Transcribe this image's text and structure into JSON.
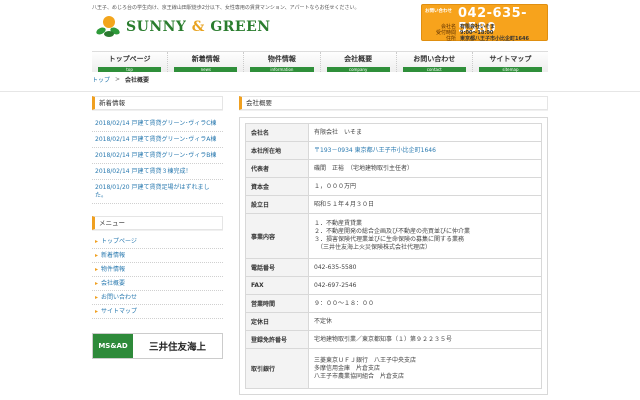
{
  "header": {
    "tagline": "八王子、めじろ台の学生向け、京王線山田駅徒歩2分以下、女性専用の賃貸マンション、アパートならお任せください。",
    "logo_left": "SUNNY",
    "logo_amp": "&",
    "logo_right": "GREEN",
    "contact_label": "お問い合わせ",
    "phone": "042-635-5580",
    "rows": [
      {
        "k": "会社名",
        "v": "有限会社いそま"
      },
      {
        "k": "受付時間",
        "v": "9:00～18:00"
      },
      {
        "k": "住所",
        "v": "東京都八王子市小比企町1646"
      }
    ]
  },
  "nav": [
    {
      "jp": "トップページ",
      "en": "top"
    },
    {
      "jp": "新着情報",
      "en": "news"
    },
    {
      "jp": "物件情報",
      "en": "information"
    },
    {
      "jp": "会社概要",
      "en": "company"
    },
    {
      "jp": "お問い合わせ",
      "en": "contact"
    },
    {
      "jp": "サイトマップ",
      "en": "sitemap"
    }
  ],
  "breadcrumb": {
    "home": "トップ",
    "sep": ">",
    "current": "会社概要"
  },
  "sidebar": {
    "news_title": "新着情報",
    "news": [
      {
        "date": "2018/02/14",
        "text": "戸建て賃貸グリーン･ヴィラC棟"
      },
      {
        "date": "2018/02/14",
        "text": "戸建て賃貸グリーン･ヴィラA棟"
      },
      {
        "date": "2018/02/14",
        "text": "戸建て賃貸グリーン･ヴィラB棟"
      },
      {
        "date": "2018/02/14",
        "text": "戸建て賃貸３棟完成！"
      },
      {
        "date": "2018/01/20",
        "text": "戸建て賃貸足場がはずれました。"
      }
    ],
    "menu_title": "メニュー",
    "menu": [
      "トップページ",
      "新着情報",
      "物件情報",
      "会社概要",
      "お問い合わせ",
      "サイトマップ"
    ],
    "banner_mark": "MS&AD",
    "banner_name": "三井住友海上"
  },
  "main": {
    "title": "会社概要",
    "rows": [
      {
        "k": "会社名",
        "lines": [
          "有限会社　いそま"
        ]
      },
      {
        "k": "本社所在地",
        "lines": [
          "〒193－0934 東京都八王子市小比企町1646"
        ],
        "blue": true
      },
      {
        "k": "代表者",
        "lines": [
          "磯間　正裕　（宅地建物取引主任者）"
        ]
      },
      {
        "k": "資本金",
        "lines": [
          "１，０００万円"
        ]
      },
      {
        "k": "設立日",
        "lines": [
          "昭和５１年４月３０日"
        ]
      },
      {
        "k": "事業内容",
        "lines": [
          "１．不動産賃貸業",
          "２．不動産開発の総合企画及び不動産の売買並びに仲介業",
          "３．損害保険代理業並びに生命保険の募集に関する業務",
          "　（三井住友海上火災保険株式会社代理店）"
        ]
      },
      {
        "k": "電話番号",
        "lines": [
          "042-635-5580"
        ]
      },
      {
        "k": "FAX",
        "lines": [
          "042-697-2546"
        ]
      },
      {
        "k": "営業時間",
        "lines": [
          "９：００～１８：００"
        ]
      },
      {
        "k": "定休日",
        "lines": [
          "不定休"
        ]
      },
      {
        "k": "登録免許番号",
        "lines": [
          "宅地建物取引業／東京都知事（１）第９２２３５号"
        ]
      },
      {
        "k": "取引銀行",
        "lines": [
          "三菱東京ＵＦＪ銀行　八王子中央支店",
          "多摩信用金庫　片倉支店",
          "八王子市農業協同組合　片倉支店"
        ]
      }
    ]
  },
  "colors": {
    "accent": "#f7a31c",
    "green": "#2f8f3a",
    "link": "#2a7ab0"
  }
}
